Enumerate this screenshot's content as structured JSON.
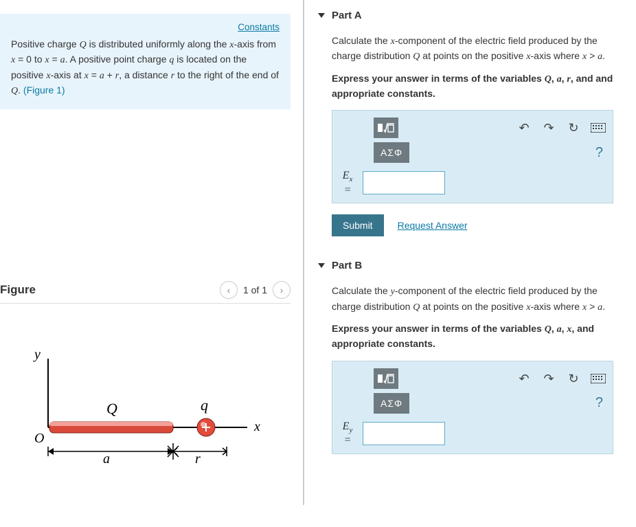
{
  "left": {
    "constants_link": "Constants",
    "problem_html": "Positive charge Q is distributed uniformly along the x-axis from x = 0 to x = a. A positive point charge q is located on the positive x-axis at x = a + r, a distance r to the right of the end of Q. ",
    "figure_link": "(Figure 1)",
    "figure_title": "Figure",
    "figure_nav": "1 of 1",
    "fig_labels": {
      "y": "y",
      "x": "x",
      "O": "O",
      "Q": "Q",
      "q": "q",
      "a": "a",
      "r": "r"
    }
  },
  "partA": {
    "title": "Part A",
    "q1": "Calculate the x-component of the electric field produced by the charge distribution Q at points on the positive x-axis where x > a.",
    "q2": "Express your answer in terms of the variables Q, a, r, and and appropriate constants.",
    "eq_label": "E",
    "eq_sub": "x",
    "submit": "Submit",
    "request": "Request Answer",
    "greek": "ΑΣΦ"
  },
  "partB": {
    "title": "Part B",
    "q1": "Calculate the y-component of the electric field produced by the charge distribution Q at points on the positive x-axis where x > a.",
    "q2": "Express your answer in terms of the variables Q, a, x, and appropriate constants.",
    "eq_label": "E",
    "eq_sub": "y",
    "greek": "ΑΣΦ"
  },
  "icons": {
    "template": "▮√▭",
    "undo": "↶",
    "redo": "↷",
    "reset": "↻",
    "keyboard": "⌨",
    "help": "?"
  }
}
